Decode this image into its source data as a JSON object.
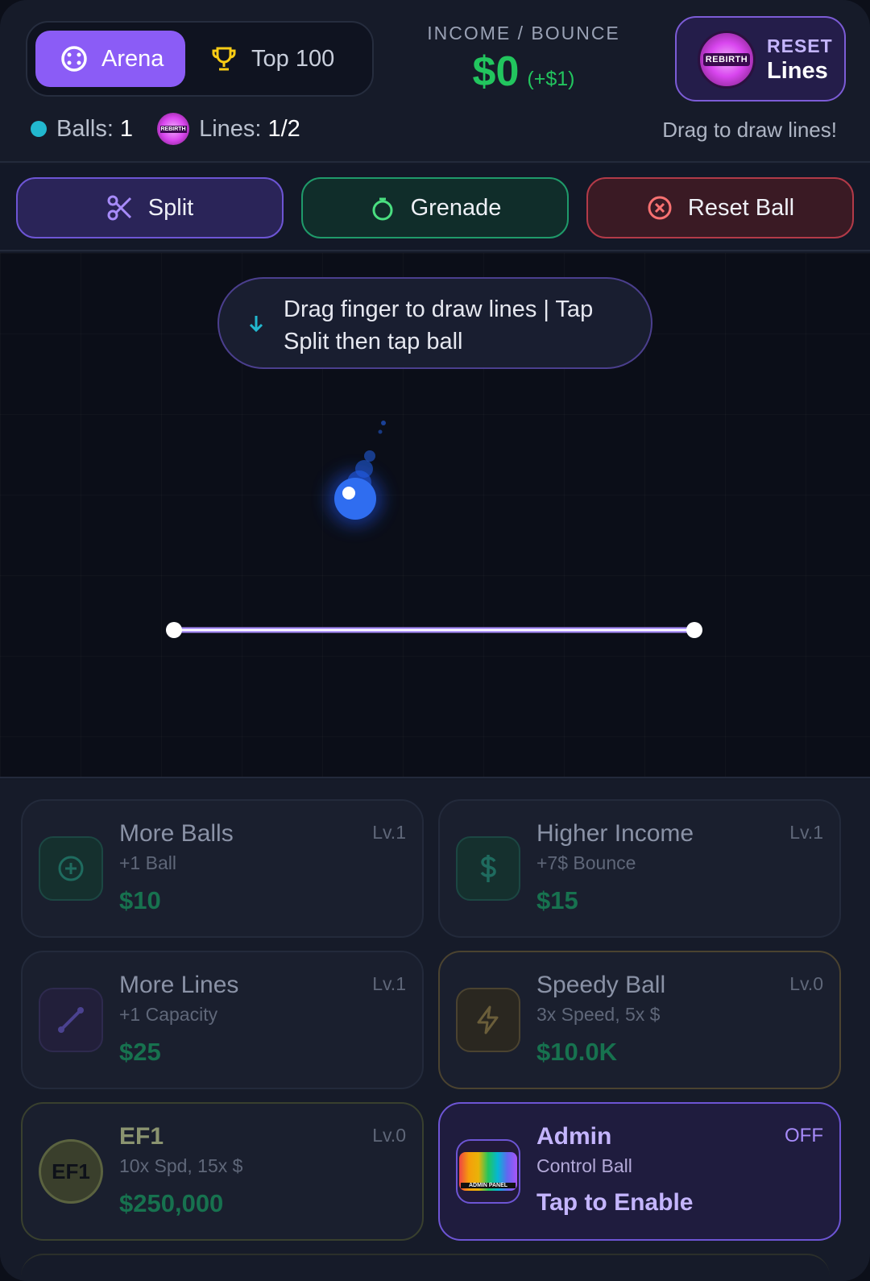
{
  "header": {
    "tabs": [
      {
        "label": "Arena",
        "icon": "target-icon",
        "active": true
      },
      {
        "label": "Top 100",
        "icon": "trophy-icon",
        "active": false
      }
    ],
    "income": {
      "label": "INCOME / BOUNCE",
      "value": "$0",
      "delta": "(+$1)"
    },
    "reset_lines": {
      "badge": "REBIRTH",
      "top": "RESET",
      "bottom": "Lines"
    },
    "stats": {
      "balls_label": "Balls:",
      "balls_value": "1",
      "lines_label": "Lines:",
      "lines_value": "1/2",
      "lines_badge": "REBIRTH"
    },
    "hint": "Drag to draw lines!"
  },
  "actions": [
    {
      "label": "Split",
      "icon": "scissors-icon"
    },
    {
      "label": "Grenade",
      "icon": "grenade-icon"
    },
    {
      "label": "Reset Ball",
      "icon": "close-circle-icon"
    }
  ],
  "arena": {
    "instruction": "Drag finger to draw lines | Tap Split then tap ball"
  },
  "upgrades": [
    {
      "title": "More Balls",
      "sub": "+1 Ball",
      "price": "$10",
      "level": "Lv.1",
      "icon": "plus-circle-icon"
    },
    {
      "title": "Higher Income",
      "sub": "+7$ Bounce",
      "price": "$15",
      "level": "Lv.1",
      "icon": "dollar-icon"
    },
    {
      "title": "More Lines",
      "sub": "+1 Capacity",
      "price": "$25",
      "level": "Lv.1",
      "icon": "line-icon"
    },
    {
      "title": "Speedy Ball",
      "sub": "3x Speed, 5x $",
      "price": "$10.0K",
      "level": "Lv.0",
      "icon": "lightning-icon"
    },
    {
      "title": "EF1",
      "sub": "10x Spd, 15x $",
      "price": "$250,000",
      "level": "Lv.0",
      "icon": "ef1-coin-icon",
      "icon_text": "EF1"
    },
    {
      "title": "Admin",
      "sub": "Control Ball",
      "price": "Tap to Enable",
      "level": "OFF",
      "icon": "admin-panel-icon",
      "icon_text": "ADMIN PANEL"
    }
  ],
  "colors": {
    "accent": "#8b5cf6",
    "income": "#22c55e",
    "ball": "#3b82f6",
    "line": "#a78bfa"
  }
}
